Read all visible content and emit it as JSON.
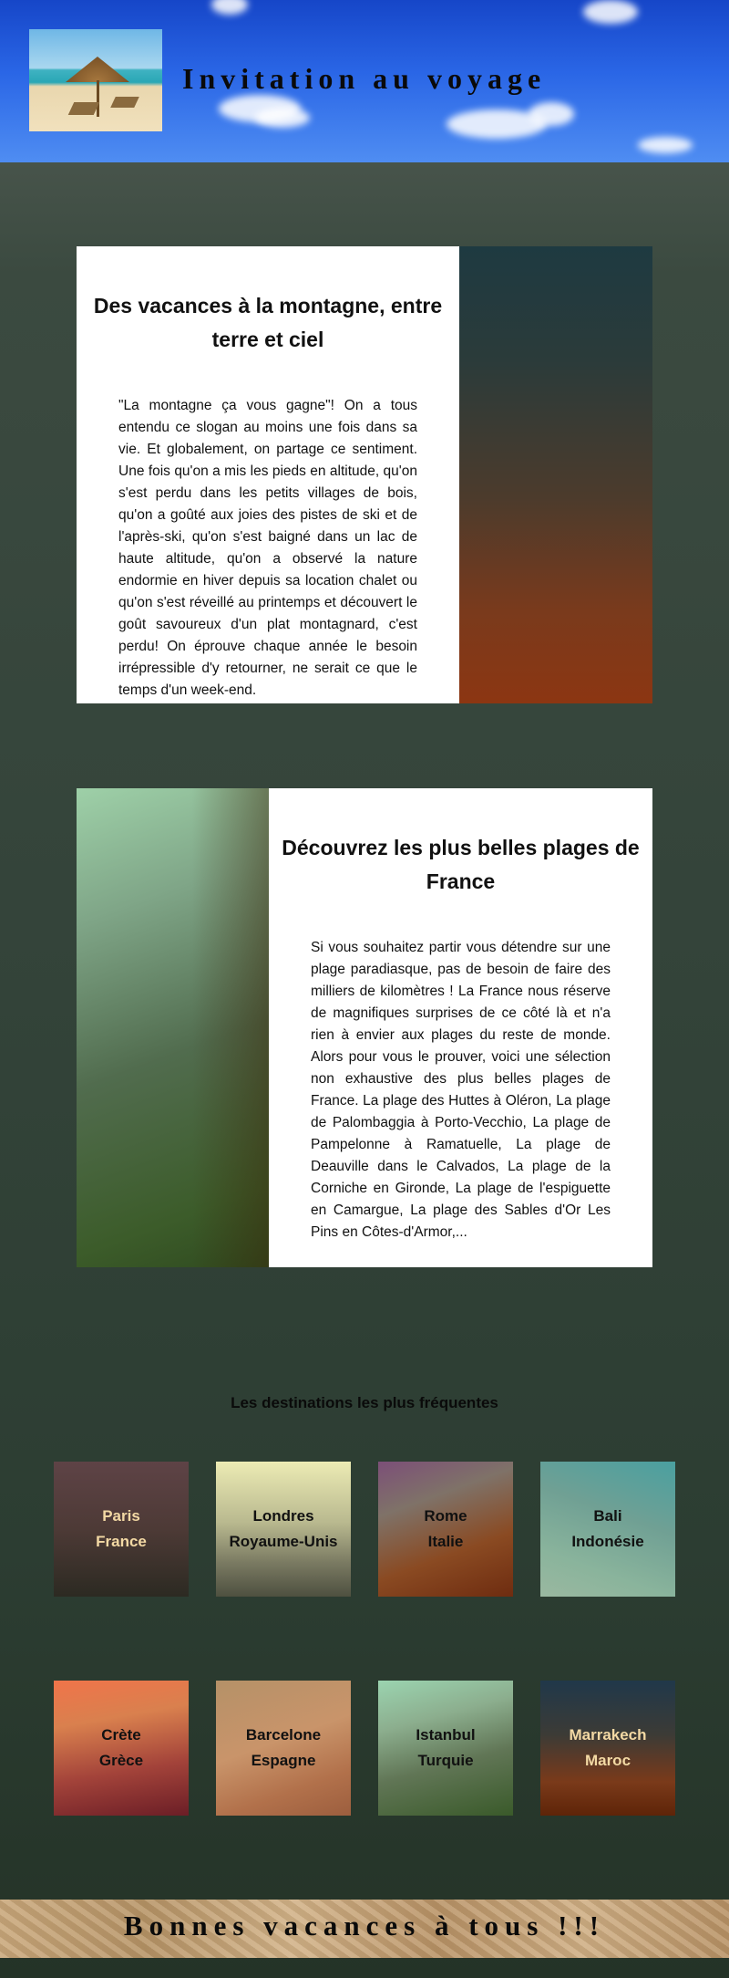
{
  "header": {
    "title": "Invitation au voyage"
  },
  "sections": [
    {
      "title": "Des vacances à la montagne, entre terre et ciel",
      "text": "\"La montagne ça vous gagne\"! On a tous entendu ce slogan au moins une fois dans sa vie. Et globalement, on partage ce sentiment. Une fois qu'on a mis les pieds en altitude, qu'on s'est perdu dans les petits villages de bois, qu'on a goûté aux joies des pistes de ski et de l'après-ski, qu'on s'est baigné dans un lac de haute altitude, qu'on a observé la nature endormie en hiver depuis sa location chalet ou qu'on s'est réveillé au printemps et découvert le goût savoureux d'un plat montagnard, c'est perdu! On éprouve chaque année le besoin irrépressible d'y retourner, ne serait ce que le temps d'un week-end."
    },
    {
      "title": "Découvrez les plus belles plages de France",
      "text": "Si vous souhaitez partir vous détendre sur une plage paradiasque, pas de besoin de faire des milliers de kilomètres ! La France nous réserve de magnifiques surprises de ce côté là et n'a rien à envier aux plages du reste de monde. Alors pour vous le prouver, voici une sélection non exhaustive des plus belles plages de France. La plage des Huttes à Oléron, La plage de Palombaggia à Porto-Vecchio, La plage de Pampelonne à Ramatuelle, La plage de Deauville dans le Calvados, La plage de la Corniche en Gironde, La plage de l'espiguette en Camargue, La plage des Sables d'Or Les Pins en Côtes-d'Armor,..."
    }
  ],
  "destinations": {
    "title": "Les destinations les plus fréquentes",
    "items": [
      {
        "city": "Paris",
        "country": "France",
        "text_color": "#f3d9a4"
      },
      {
        "city": "Londres",
        "country": "Royaume-Unis",
        "text_color": "#111111"
      },
      {
        "city": "Rome",
        "country": "Italie",
        "text_color": "#111111"
      },
      {
        "city": "Bali",
        "country": "Indonésie",
        "text_color": "#111111"
      },
      {
        "city": "Crète",
        "country": "Grèce",
        "text_color": "#111111"
      },
      {
        "city": "Barcelone",
        "country": "Espagne",
        "text_color": "#111111"
      },
      {
        "city": "Istanbul",
        "country": "Turquie",
        "text_color": "#111111"
      },
      {
        "city": "Marrakech",
        "country": "Maroc",
        "text_color": "#f3d9a4"
      }
    ]
  },
  "footer": {
    "text": "Bonnes vacances à tous !!!"
  }
}
